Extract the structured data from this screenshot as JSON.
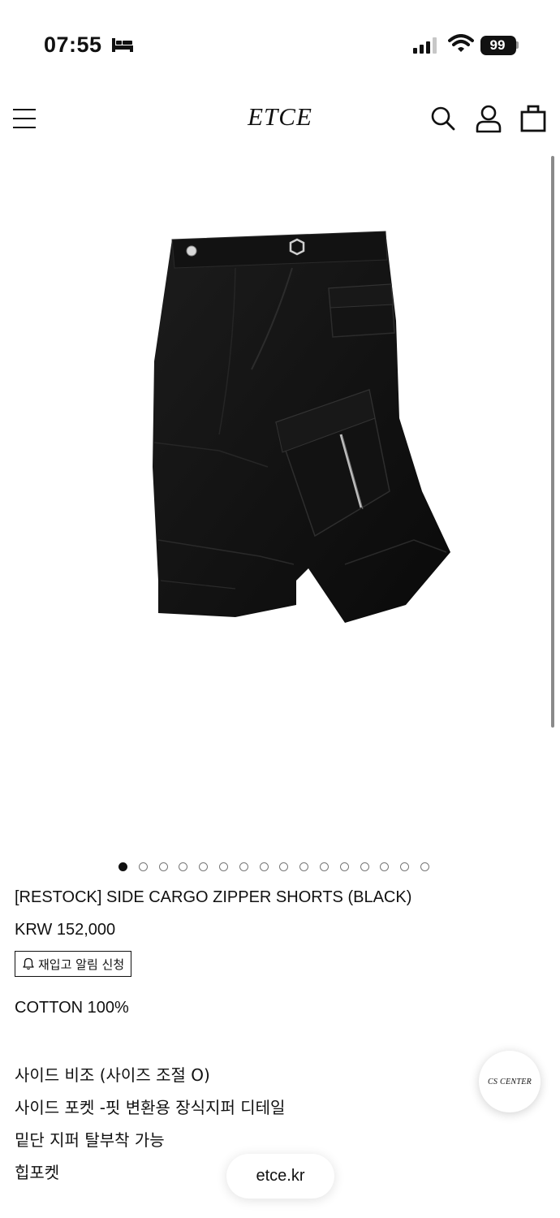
{
  "status_bar": {
    "time": "07:55",
    "battery": "99",
    "sleep_icon": "bed-icon",
    "signal_icon": "cellular-signal-icon",
    "wifi_icon": "wifi-icon"
  },
  "header": {
    "logo": "ETCE",
    "menu_icon": "hamburger-menu-icon",
    "search_icon": "search-icon",
    "account_icon": "user-icon",
    "cart_icon": "shopping-bag-icon"
  },
  "carousel": {
    "total_slides": 16,
    "active_index": 0
  },
  "product": {
    "title": "[RESTOCK] SIDE CARGO ZIPPER SHORTS (BLACK)",
    "price": "KRW 152,000",
    "restock_button": "재입고 알림 신청",
    "restock_icon": "bell-icon"
  },
  "description": {
    "material": "COTTON 100%",
    "lines": [
      "사이드 비조 (사이즈 조절 O)",
      "사이드 포켓  -핏 변환용 장식지퍼 디테일",
      "밑단 지퍼 탈부착 가능",
      "힙포켓"
    ]
  },
  "cs_center": {
    "label": "CS CENTER"
  },
  "browser": {
    "url": "etce.kr"
  },
  "colors": {
    "text": "#111111",
    "background": "#ffffff",
    "product": "#141414"
  }
}
